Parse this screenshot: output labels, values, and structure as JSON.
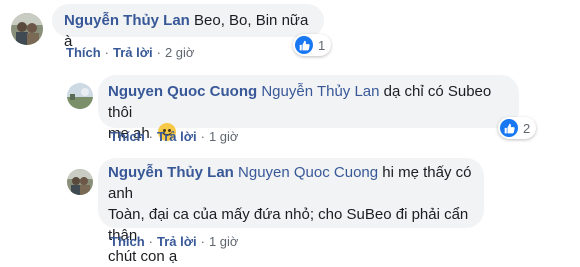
{
  "actions": {
    "like_label": "Thích",
    "reply_label": "Trả lời",
    "separator": "·"
  },
  "comments": [
    {
      "author": "Nguyễn Thủy Lan",
      "tag": "",
      "text": "Beo, Bo, Bin nữa à",
      "time": "2 giờ",
      "reaction_count": "1"
    },
    {
      "author": "Nguyen Quoc Cuong",
      "tag": "Nguyễn Thủy Lan",
      "text_line1": "dạ chỉ có Subeo thôi",
      "text_line2": "mẹ ạh",
      "emoji": "smile-emoji",
      "time": "1 giờ",
      "reaction_count": "2"
    },
    {
      "author": "Nguyễn Thủy Lan",
      "tag": "Nguyen Quoc Cuong",
      "text_line1": "hi mẹ thấy có anh",
      "text_line2": "Toàn, đại ca của mấy đứa nhỏ; cho SuBeo đi phải cẩn thận",
      "text_line3": "chút con ạ",
      "time": "1 giờ"
    }
  ],
  "colors": {
    "link": "#385898",
    "bubble": "#f2f3f5",
    "like": "#1877f2"
  }
}
